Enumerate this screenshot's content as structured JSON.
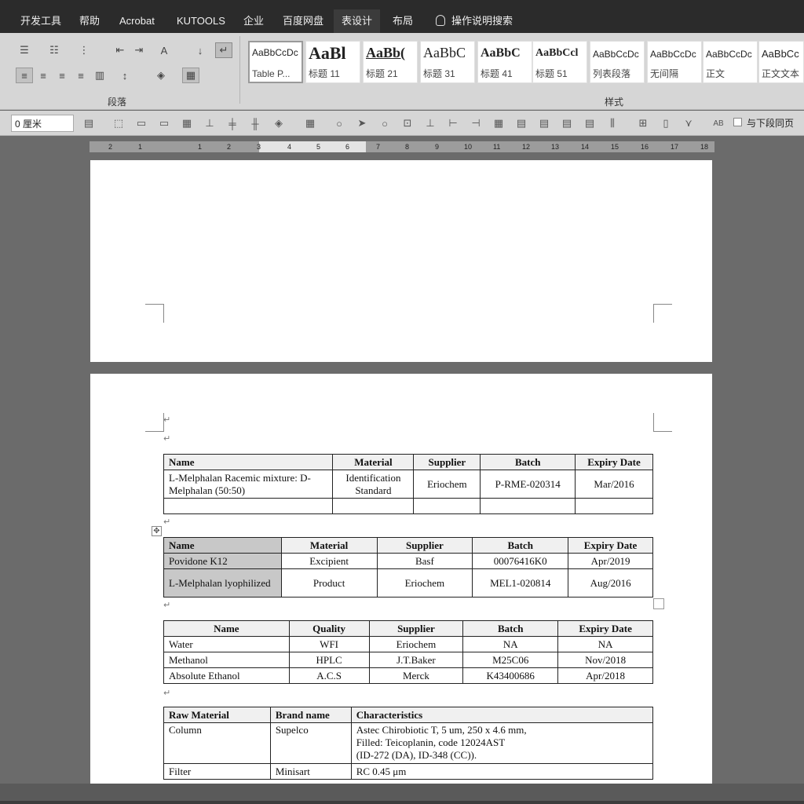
{
  "menu": {
    "items": [
      "开发工具",
      "帮助",
      "Acrobat",
      "KUTOOLS",
      "企业",
      "百度网盘",
      "表设计",
      "布局"
    ],
    "active_index": 6,
    "tell_me": "操作说明搜索"
  },
  "ribbon": {
    "paragraph_group_label": "段落",
    "styles_group_label": "样式",
    "styles": [
      {
        "preview": "AaBbCcDc",
        "name": "Table P..."
      },
      {
        "preview": "AaBl",
        "name": "标题 11"
      },
      {
        "preview": "AaBb(",
        "name": "标题 21"
      },
      {
        "preview": "AaBbC",
        "name": "标题 31"
      },
      {
        "preview": "AaBbC",
        "name": "标题 41"
      },
      {
        "preview": "AaBbCcl",
        "name": "标题 51"
      },
      {
        "preview": "AaBbCcDc",
        "name": "列表段落"
      },
      {
        "preview": "AaBbCcDc",
        "name": "无间隔"
      },
      {
        "preview": "AaBbCcDc",
        "name": "正文"
      },
      {
        "preview": "AaBbCc",
        "name": "正文文本"
      }
    ]
  },
  "toolbar2": {
    "spacing_value": "0 厘米",
    "keep_with_next_label": "与下段同页"
  },
  "ruler": {
    "numbers": [
      "2",
      "1",
      "1",
      "2",
      "3",
      "4",
      "5",
      "6",
      "7",
      "8",
      "9",
      "10",
      "11",
      "12",
      "13",
      "14",
      "15",
      "16",
      "17",
      "18"
    ]
  },
  "table1": {
    "headers": [
      "Name",
      "Material",
      "Supplier",
      "Batch",
      "Expiry Date"
    ],
    "rows": [
      [
        "L-Melphalan Racemic mixture: D-Melphalan (50:50)",
        "Identification Standard",
        "Eriochem",
        "P-RME-020314",
        "Mar/2016"
      ],
      [
        "",
        "",
        "",
        "",
        ""
      ]
    ]
  },
  "table2": {
    "headers": [
      "Name",
      "Material",
      "Supplier",
      "Batch",
      "Expiry Date"
    ],
    "rows": [
      [
        "Povidone K12",
        "Excipient",
        "Basf",
        "00076416K0",
        "Apr/2019"
      ],
      [
        "L-Melphalan lyophilized",
        "Product",
        "Eriochem",
        "MEL1-020814",
        "Aug/2016"
      ]
    ]
  },
  "table3": {
    "headers": [
      "Name",
      "Quality",
      "Supplier",
      "Batch",
      "Expiry Date"
    ],
    "rows": [
      [
        "Water",
        "WFI",
        "Eriochem",
        "NA",
        "NA"
      ],
      [
        "Methanol",
        "HPLC",
        "J.T.Baker",
        "M25C06",
        "Nov/2018"
      ],
      [
        "Absolute Ethanol",
        "A.C.S",
        "Merck",
        "K43400686",
        "Apr/2018"
      ]
    ]
  },
  "table4": {
    "headers": [
      "Raw Material",
      "Brand name",
      "Characteristics"
    ],
    "rows": [
      [
        "Column",
        "Supelco",
        "Astec Chirobiotic T, 5 um, 250 x 4.6 mm,",
        "Filled: Teicoplanin, code 12024AST",
        "(ID-272 (DA), ID-348 (CC))."
      ],
      [
        "Filter",
        "Minisart",
        "RC 0.45 μm"
      ]
    ]
  }
}
